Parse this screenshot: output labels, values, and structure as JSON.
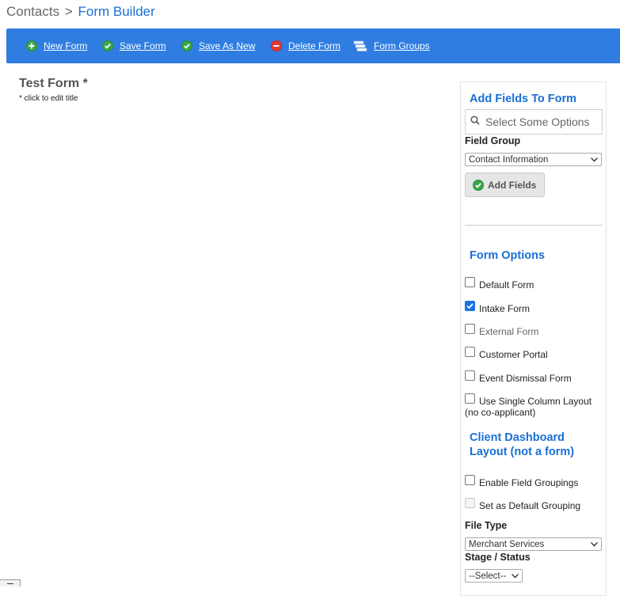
{
  "breadcrumb": {
    "root": "Contacts",
    "separator": ">",
    "current": "Form Builder"
  },
  "toolbar": {
    "items": [
      {
        "label": "New Form",
        "icon": "plus-circle-icon",
        "color": "#3aa64a"
      },
      {
        "label": "Save Form",
        "icon": "check-circle-icon",
        "color": "#3aa64a"
      },
      {
        "label": "Save As New",
        "icon": "check-circle-icon",
        "color": "#3aa64a"
      },
      {
        "label": "Delete Form",
        "icon": "minus-circle-icon",
        "color": "#e53935"
      },
      {
        "label": "Form Groups",
        "icon": "stack-icon",
        "color": "#ffffff"
      }
    ]
  },
  "form": {
    "title": "Test Form *",
    "hint": "* click to edit title"
  },
  "panel": {
    "add_fields": {
      "title": "Add Fields To Form",
      "search_placeholder": "Select Some Options",
      "field_group_label": "Field Group",
      "field_group_value": "Contact Information",
      "add_button_label": "Add Fields"
    },
    "form_options": {
      "title": "Form Options",
      "items": [
        {
          "label": "Default Form",
          "checked": false,
          "disabled": false
        },
        {
          "label": "Intake Form",
          "checked": true,
          "disabled": false
        },
        {
          "label": "External Form",
          "checked": false,
          "disabled": false
        },
        {
          "label": "Customer Portal",
          "checked": false,
          "disabled": false
        },
        {
          "label": "Event Dismissal Form",
          "checked": false,
          "disabled": false
        },
        {
          "label": "Use Single Column Layout",
          "label2": "(no co-applicant)",
          "checked": false,
          "disabled": false
        }
      ]
    },
    "dashboard": {
      "title_line1": "Client Dashboard",
      "title_line2": "Layout (not a form)",
      "items": [
        {
          "label": "Enable Field Groupings",
          "checked": false,
          "disabled": false
        },
        {
          "label": "Set as Default Grouping",
          "checked": false,
          "disabled": true
        }
      ],
      "file_type_label": "File Type",
      "file_type_value": "Merchant Services",
      "stage_label": "Stage / Status",
      "stage_value": "--Select--"
    }
  },
  "colors": {
    "accent": "#2f7de1",
    "link": "#1a6fd6"
  }
}
